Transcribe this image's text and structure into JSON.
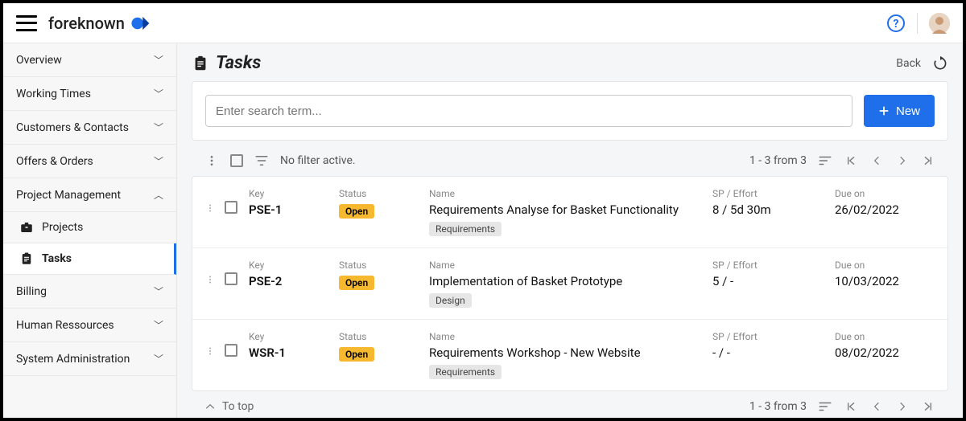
{
  "brand": "foreknown",
  "sidebar": {
    "items": [
      {
        "label": "Overview",
        "expanded": false
      },
      {
        "label": "Working Times",
        "expanded": false
      },
      {
        "label": "Customers & Contacts",
        "expanded": false
      },
      {
        "label": "Offers & Orders",
        "expanded": false
      },
      {
        "label": "Project Management",
        "expanded": true
      },
      {
        "label": "Billing",
        "expanded": false
      },
      {
        "label": "Human Ressources",
        "expanded": false
      },
      {
        "label": "System Administration",
        "expanded": false
      }
    ],
    "pm_children": [
      {
        "label": "Projects",
        "active": false
      },
      {
        "label": "Tasks",
        "active": true
      }
    ]
  },
  "page": {
    "title": "Tasks",
    "back": "Back",
    "search_placeholder": "Enter search term...",
    "new_btn": "New",
    "no_filter": "No filter active.",
    "pager": "1 - 3 from 3",
    "to_top": "To top"
  },
  "columns": {
    "key": "Key",
    "status": "Status",
    "name": "Name",
    "sp": "SP / Effort",
    "due": "Due on"
  },
  "tasks": [
    {
      "key": "PSE-1",
      "status": "Open",
      "name": "Requirements Analyse for Basket Functionality",
      "tag": "Requirements",
      "sp": "8 / 5d 30m",
      "due": "26/02/2022"
    },
    {
      "key": "PSE-2",
      "status": "Open",
      "name": "Implementation of Basket Prototype",
      "tag": "Design",
      "sp": "5 / -",
      "due": "10/03/2022"
    },
    {
      "key": "WSR-1",
      "status": "Open",
      "name": "Requirements Workshop - New Website",
      "tag": "Requirements",
      "sp": "- / -",
      "due": "08/02/2022"
    }
  ]
}
